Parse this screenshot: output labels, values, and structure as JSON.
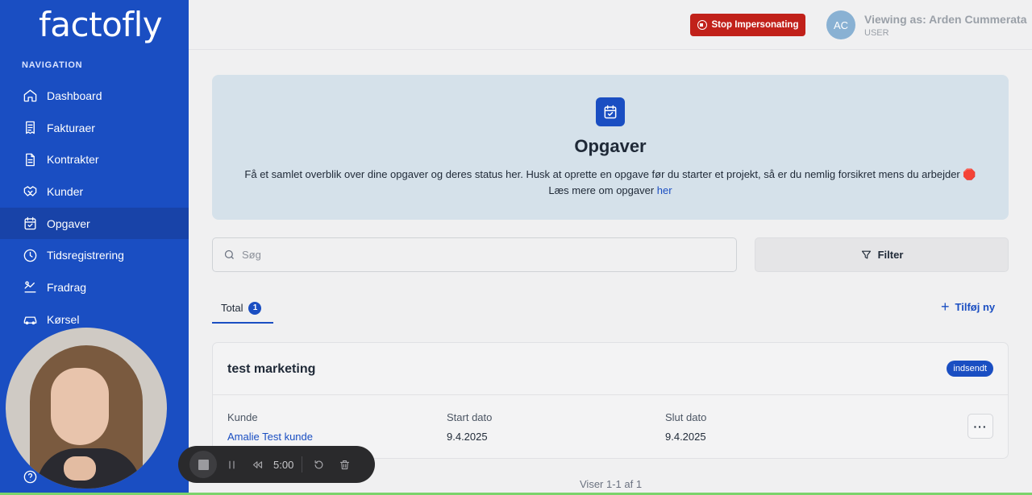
{
  "brand": {
    "logo_text": "factofly"
  },
  "sidebar": {
    "heading": "NAVIGATION",
    "items": [
      {
        "label": "Dashboard",
        "icon": "home-icon"
      },
      {
        "label": "Fakturaer",
        "icon": "invoice-icon"
      },
      {
        "label": "Kontrakter",
        "icon": "document-icon"
      },
      {
        "label": "Kunder",
        "icon": "handshake-icon"
      },
      {
        "label": "Opgaver",
        "icon": "calendar-check-icon",
        "active": true
      },
      {
        "label": "Tidsregistrering",
        "icon": "clock-icon"
      },
      {
        "label": "Fradrag",
        "icon": "deduction-icon"
      },
      {
        "label": "Kørsel",
        "icon": "car-icon"
      }
    ]
  },
  "topbar": {
    "stop_label": "Stop Impersonating",
    "avatar_initials": "AC",
    "viewing_as": "Viewing as: Arden Cummerata",
    "role": "USER"
  },
  "hero": {
    "title": "Opgaver",
    "text": "Få et samlet overblik over dine opgaver og deres status her. Husk at oprette en opgave før du starter et projekt, så er du nemlig forsikret mens du arbejder 🛑 Læs mere om opgaver",
    "link": "her"
  },
  "search": {
    "placeholder": "Søg"
  },
  "filter": {
    "label": "Filter"
  },
  "tabs": [
    {
      "label": "Total",
      "count": "1"
    }
  ],
  "add_new": {
    "label": "Tilføj ny"
  },
  "tasks": [
    {
      "title": "test marketing",
      "status": "indsendt",
      "customer_label": "Kunde",
      "customer": "Amalie Test kunde",
      "start_label": "Start dato",
      "start": "9.4.2025",
      "end_label": "Slut dato",
      "end": "9.4.2025",
      "more": "···"
    }
  ],
  "pagination": "Viser 1-1 af 1",
  "recorder": {
    "time": "5:00"
  },
  "colors": {
    "primary": "#1a4ec2",
    "danger": "#c1211a",
    "hero_bg": "#d5e1ea"
  }
}
